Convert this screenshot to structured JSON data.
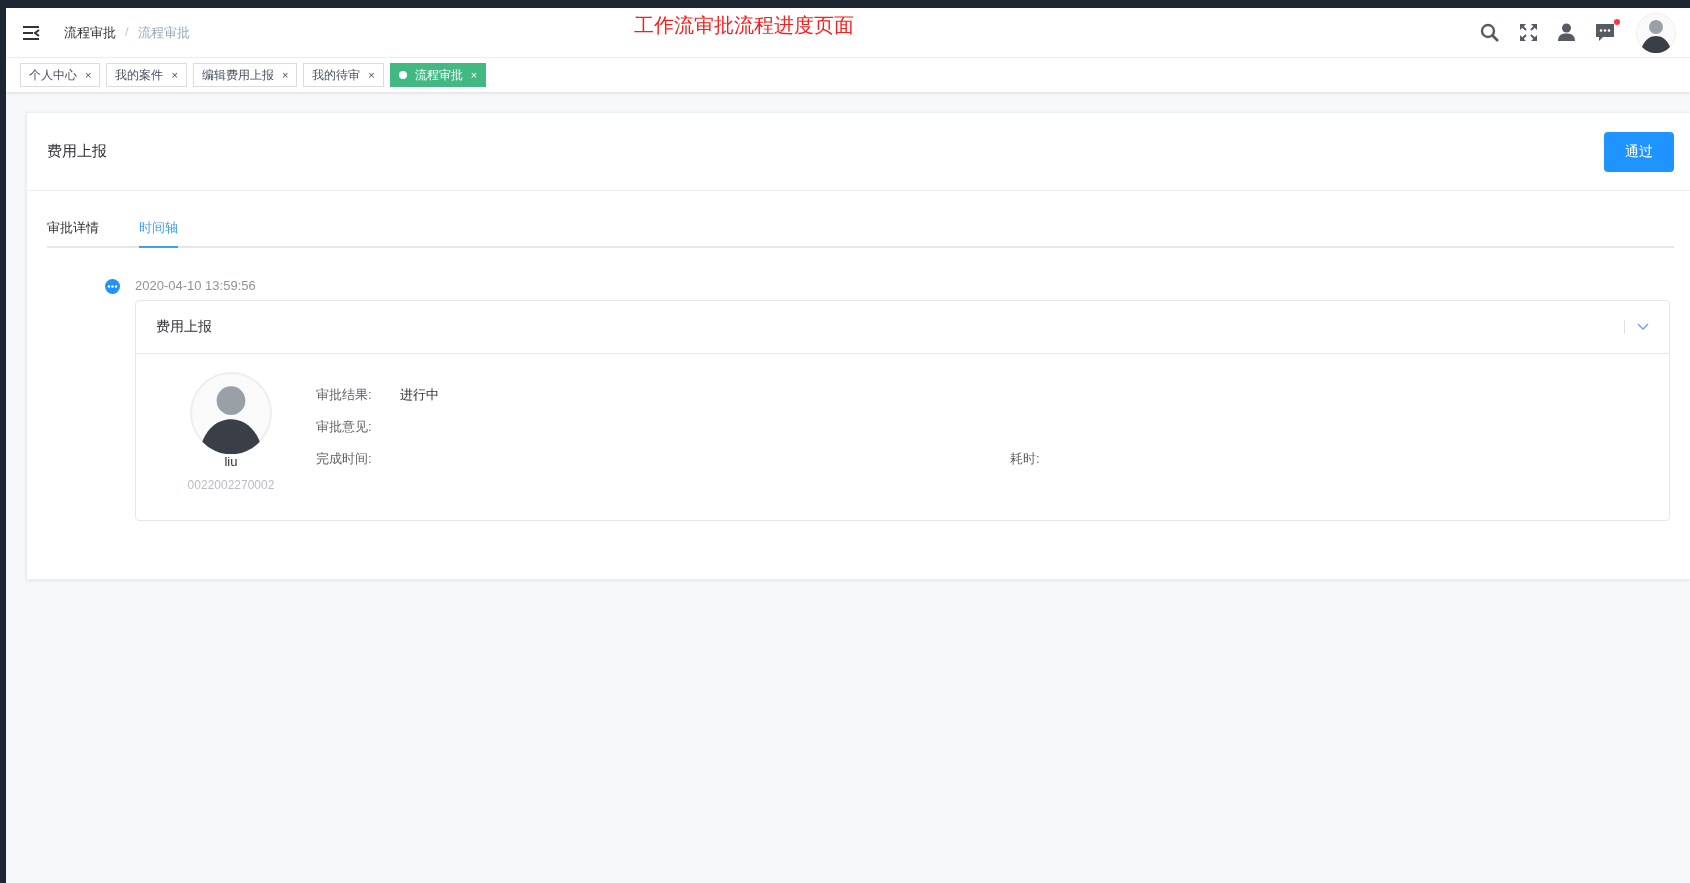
{
  "header": {
    "breadcrumb": {
      "separator": "/",
      "items": [
        {
          "label": "流程审批",
          "current": false
        },
        {
          "label": "流程审批",
          "current": true
        }
      ]
    },
    "annotation": "工作流审批流程进度页面",
    "notification_dot": true
  },
  "tags": [
    {
      "label": "个人中心",
      "close": "×",
      "selected": false
    },
    {
      "label": "我的案件",
      "close": "×",
      "selected": false
    },
    {
      "label": "编辑费用上报",
      "close": "×",
      "selected": false
    },
    {
      "label": "我的待审",
      "close": "×",
      "selected": false
    },
    {
      "label": "流程审批",
      "close": "×",
      "selected": true
    }
  ],
  "card": {
    "title": "费用上报",
    "approve_button": "通过"
  },
  "tabs": [
    {
      "label": "审批详情",
      "selected": false
    },
    {
      "label": "时间轴",
      "selected": true
    }
  ],
  "timeline": [
    {
      "timestamp": "2020-04-10 13:59:56",
      "title": "费用上报",
      "expanded": true,
      "user": {
        "name": "liu",
        "id": "0022002270002"
      },
      "fields": [
        {
          "label": "审批结果:",
          "value": "进行中"
        },
        {
          "label": "审批意见:"
        },
        {
          "label": "完成时间:",
          "extra_label": "耗时:"
        }
      ]
    }
  ]
}
